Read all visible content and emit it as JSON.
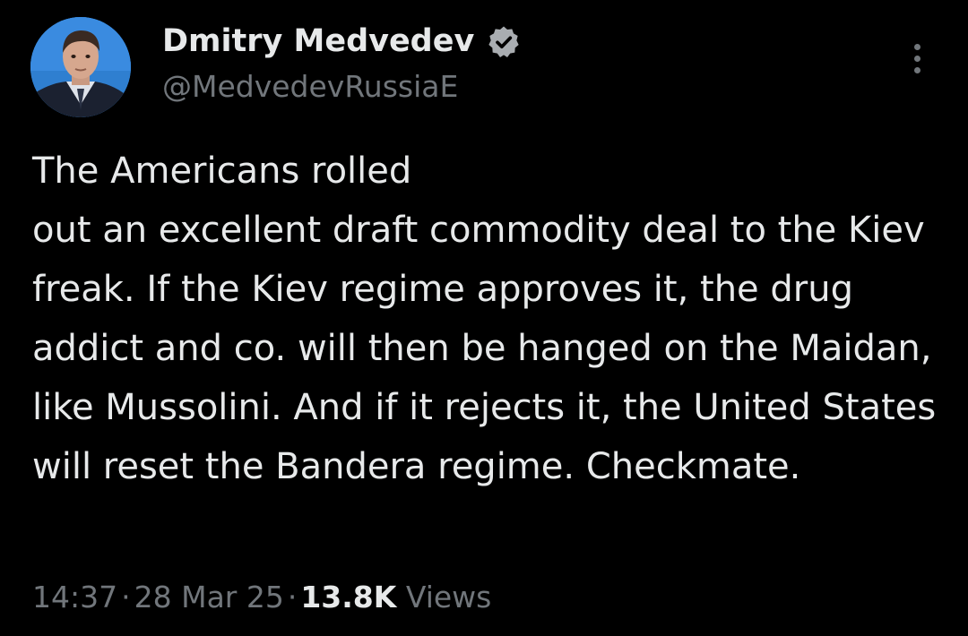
{
  "author": {
    "display_name": "Dmitry Medvedev",
    "handle": "@MedvedevRussiaE",
    "verified": true,
    "avatar": "profile-photo"
  },
  "post": {
    "text": "The Americans rolled\nout an excellent draft commodity deal to the Kiev freak. If the Kiev regime approves it, the drug addict and co. will then be hanged on the Maidan, like Mussolini. And if it rejects it, the United States will reset the Bandera regime. Checkmate."
  },
  "meta": {
    "time": "14:37",
    "separator": "·",
    "date": "28 Mar 25",
    "views_count": "13.8K",
    "views_label": "Views"
  },
  "icons": {
    "verified": "verified-badge-icon",
    "more": "more-options-icon"
  },
  "colors": {
    "background": "#000000",
    "primary_text": "#e7e9ea",
    "secondary_text": "#71767b",
    "verified_badge": "#a9adb1"
  }
}
